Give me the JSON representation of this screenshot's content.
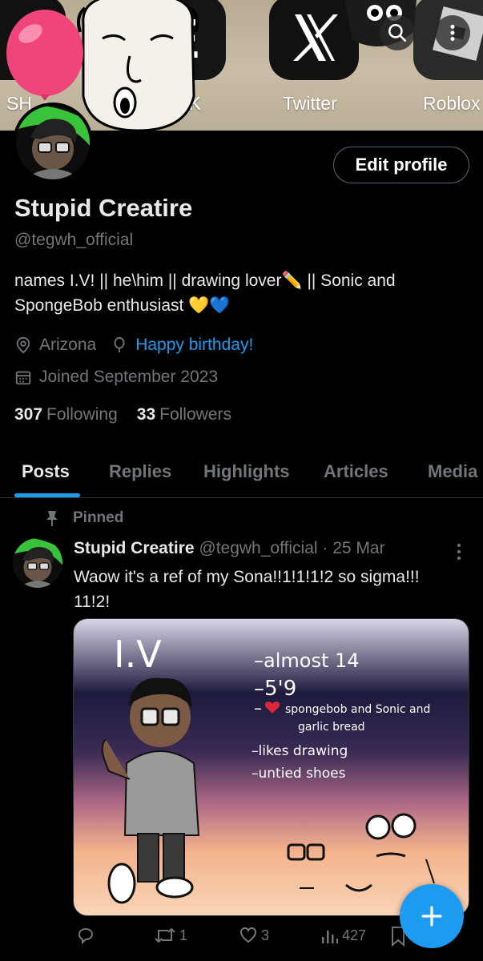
{
  "banner": {
    "apps": [
      {
        "label": "SH"
      },
      {
        "label": "PIK"
      },
      {
        "label": "Twitter"
      },
      {
        "label": "Roblox"
      }
    ]
  },
  "icons": {
    "search": "search-icon",
    "more": "more-vertical-icon",
    "location": "location-pin-icon",
    "birthday": "balloon-icon",
    "calendar": "calendar-icon",
    "pin": "pin-icon",
    "reply": "reply-icon",
    "repost": "repost-icon",
    "like": "heart-icon",
    "views": "views-icon",
    "bookmark": "bookmark-icon",
    "compose": "plus-icon"
  },
  "profile": {
    "edit_label": "Edit profile",
    "name": "Stupid Creatire",
    "handle": "@tegwh_official",
    "bio_line1": "names I.V! || he\\him || drawing lover✏️ || Sonic and",
    "bio_line2": "SpongeBob enthusiast 💛💙",
    "location": "Arizona",
    "birthday": "Happy birthday!",
    "joined": "Joined September 2023",
    "following_count": "307",
    "following_label": "Following",
    "followers_count": "33",
    "followers_label": "Followers"
  },
  "tabs": [
    "Posts",
    "Replies",
    "Highlights",
    "Articles",
    "Media"
  ],
  "post": {
    "pinned_label": "Pinned",
    "author": "Stupid Creatire",
    "meta": "@tegwh_official · 25 Mar",
    "text_line1": "Waow it's a ref of my Sona!!1!1!1!2 so sigma!!!",
    "text_line2": "11!2!",
    "image_text": {
      "title": "I.V",
      "line1": "–almost 14",
      "line2": "–5'9",
      "line3a": "spongebob and Sonic and",
      "line3b": "garlic bread",
      "line4": "–likes drawing",
      "line5": "–untied shoes"
    },
    "reply_count": "",
    "repost_count": "1",
    "like_count": "3",
    "views_count": "427"
  },
  "colors": {
    "accent": "#1d9bf0",
    "background": "#000000",
    "text_primary": "#e7e9ea",
    "text_secondary": "#71767b"
  }
}
